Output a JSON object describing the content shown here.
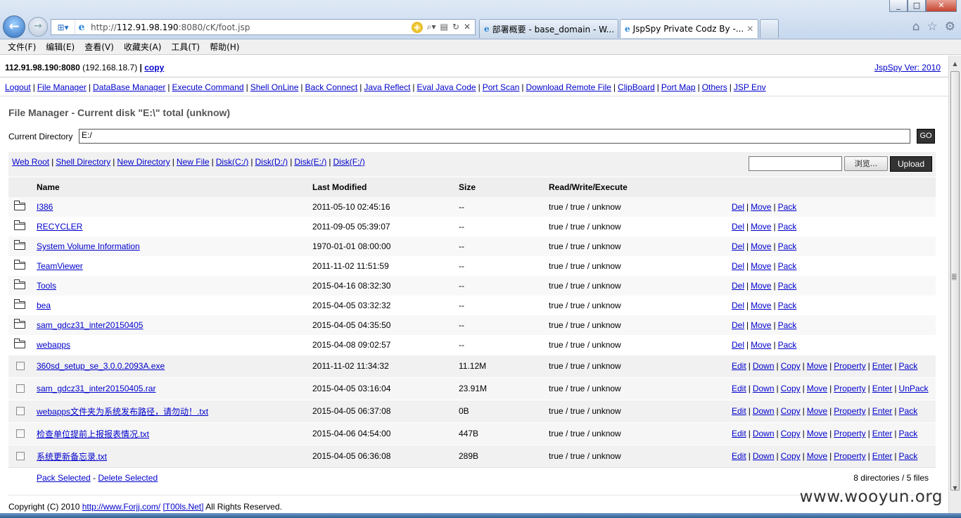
{
  "browser": {
    "address": {
      "prefix": "http://",
      "host": "112.91.98.190",
      "path": ":8080/cK/foot.jsp"
    },
    "tabs": [
      {
        "label": "部署概要 - base_domain - W..."
      },
      {
        "label": "JspSpy Private Codz By -..."
      }
    ],
    "menu": [
      "文件(F)",
      "编辑(E)",
      "查看(V)",
      "收藏夹(A)",
      "工具(T)",
      "帮助(H)"
    ]
  },
  "header": {
    "server": "112.91.98.190:8080",
    "local_ip": "(192.168.18.7)",
    "pipe": "|",
    "copy_label": "copy",
    "version_label": "JspSpy Ver: 2010"
  },
  "nav": [
    "Logout",
    "File Manager",
    "DataBase Manager",
    "Execute Command",
    "Shell OnLine",
    "Back Connect",
    "Java Reflect",
    "Eval Java Code",
    "Port Scan",
    "Download Remote File",
    "ClipBoard",
    "Port Map",
    "Others",
    "JSP Env"
  ],
  "file_manager": {
    "title": "File Manager - Current disk \"E:\\\" total (unknow)",
    "current_dir_label": "Current Directory",
    "current_dir_value": "E:/",
    "go_label": "GO",
    "toolbar_links": [
      "Web Root",
      "Shell Directory",
      "New Directory",
      "New File",
      "Disk(C:/)",
      "Disk(D:/)",
      "Disk(E:/)",
      "Disk(F:/)"
    ],
    "browse_label": "浏览...",
    "upload_label": "Upload",
    "columns": {
      "name": "Name",
      "modified": "Last Modified",
      "size": "Size",
      "perm": "Read/Write/Execute"
    },
    "dir_actions": [
      "Del",
      "Move",
      "Pack"
    ],
    "directories": [
      {
        "name": "I386",
        "modified": "2011-05-10 02:45:16",
        "size": "--",
        "perm": "true / true / unknow"
      },
      {
        "name": "RECYCLER",
        "modified": "2011-09-05 05:39:07",
        "size": "--",
        "perm": "true / true / unknow"
      },
      {
        "name": "System Volume Information",
        "modified": "1970-01-01 08:00:00",
        "size": "--",
        "perm": "true / true / unknow"
      },
      {
        "name": "TeamViewer",
        "modified": "2011-11-02 11:51:59",
        "size": "--",
        "perm": "true / true / unknow"
      },
      {
        "name": "Tools",
        "modified": "2015-04-16 08:32:30",
        "size": "--",
        "perm": "true / true / unknow"
      },
      {
        "name": "bea",
        "modified": "2015-04-05 03:32:32",
        "size": "--",
        "perm": "true / true / unknow"
      },
      {
        "name": "sam_gdcz31_inter20150405",
        "modified": "2015-04-05 04:35:50",
        "size": "--",
        "perm": "true / true / unknow"
      },
      {
        "name": "webapps",
        "modified": "2015-04-08 09:02:57",
        "size": "--",
        "perm": "true / true / unknow"
      }
    ],
    "files": [
      {
        "name": "360sd_setup_se_3.0.0.2093A.exe",
        "modified": "2011-11-02 11:34:32",
        "size": "11.12M",
        "perm": "true / true / unknow",
        "actions": [
          "Edit",
          "Down",
          "Copy",
          "Move",
          "Property",
          "Enter",
          "Pack"
        ]
      },
      {
        "name": "sam_gdcz31_inter20150405.rar",
        "modified": "2015-04-05 03:16:04",
        "size": "23.91M",
        "perm": "true / true / unknow",
        "actions": [
          "Edit",
          "Down",
          "Copy",
          "Move",
          "Property",
          "Enter",
          "UnPack"
        ]
      },
      {
        "name": "webapps文件夹为系统发布路径，请勿动！.txt",
        "modified": "2015-04-05 06:37:08",
        "size": "0B",
        "perm": "true / true / unknow",
        "actions": [
          "Edit",
          "Down",
          "Copy",
          "Move",
          "Property",
          "Enter",
          "Pack"
        ]
      },
      {
        "name": "检查单位提前上报报表情况.txt",
        "modified": "2015-04-06 04:54:00",
        "size": "447B",
        "perm": "true / true / unknow",
        "actions": [
          "Edit",
          "Down",
          "Copy",
          "Move",
          "Property",
          "Enter",
          "Pack"
        ]
      },
      {
        "name": "系统更新备忘录.txt",
        "modified": "2015-04-05 06:36:08",
        "size": "289B",
        "perm": "true / true / unknow",
        "actions": [
          "Edit",
          "Down",
          "Copy",
          "Move",
          "Property",
          "Enter",
          "Pack"
        ]
      }
    ],
    "pack_selected": "Pack Selected",
    "delete_selected": "Delete Selected",
    "summary": "8 directories / 5 files"
  },
  "footer": {
    "copyright": "Copyright (C) 2010",
    "link1": "http://www.Forjj.com/",
    "link2": "[T00ls.Net]",
    "rights": "All Rights Reserved."
  },
  "watermark": "www.wooyun.org"
}
